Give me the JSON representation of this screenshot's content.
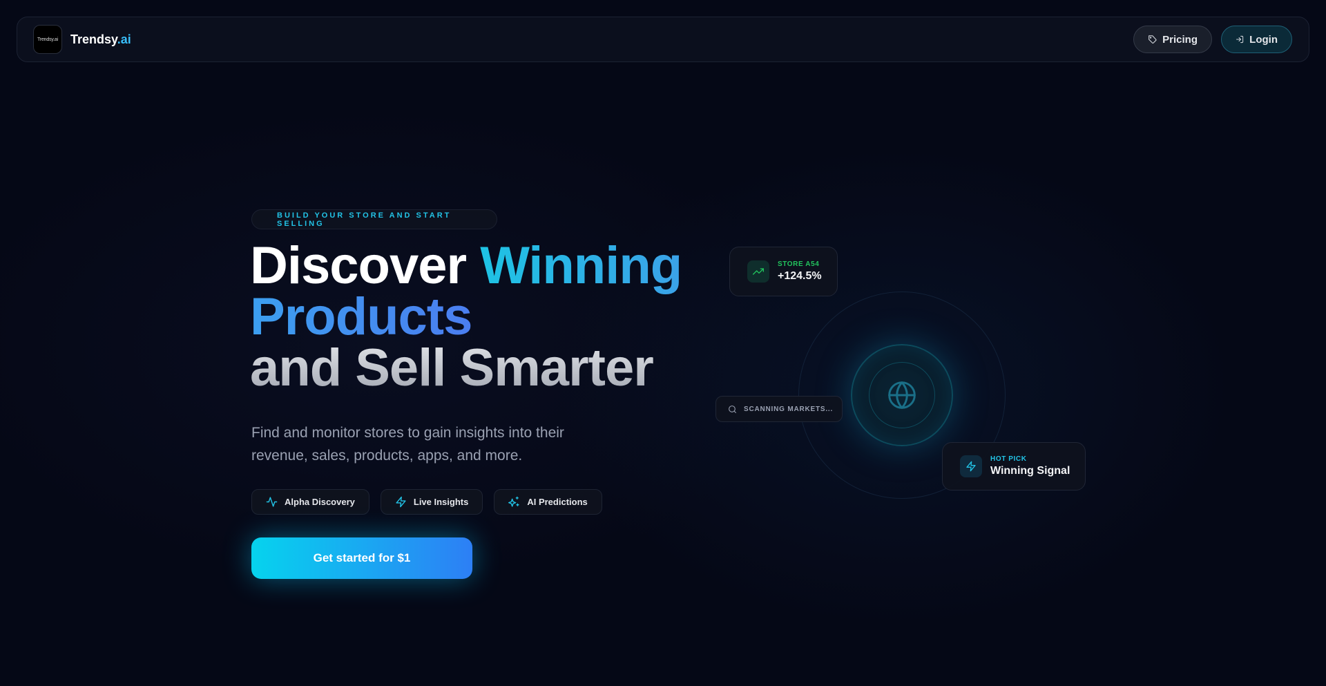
{
  "brand": {
    "logo_text": "Trendsy.ai",
    "name_main": "Trendsy",
    "name_accent": ".ai"
  },
  "nav": {
    "pricing_label": "Pricing",
    "login_label": "Login"
  },
  "hero": {
    "eyebrow": "BUILD YOUR STORE AND START SELLING",
    "headline_part1": "Discover ",
    "headline_part2": "Winning",
    "headline_part3": "Products",
    "headline_part4": "and Sell Smarter",
    "subtitle": "Find and monitor stores to gain insights into their revenue, sales, products, apps, and more.",
    "features": [
      {
        "label": "Alpha Discovery",
        "icon": "activity-icon"
      },
      {
        "label": "Live Insights",
        "icon": "zap-icon"
      },
      {
        "label": "AI Predictions",
        "icon": "sparkles-icon"
      }
    ],
    "cta_label": "Get started for $1"
  },
  "visual": {
    "store_card": {
      "label": "STORE A54",
      "value": "+124.5%",
      "icon": "trending-up-icon"
    },
    "scan_text": "SCANNING MARKETS...",
    "hot_card": {
      "label": "HOT PICK",
      "value": "Winning Signal",
      "icon": "zap-icon"
    },
    "center_icon": "globe-icon"
  },
  "colors": {
    "background": "#050816",
    "accent_cyan": "#22c3e6",
    "accent_blue": "#2d7ff5",
    "positive_green": "#22c55e"
  }
}
